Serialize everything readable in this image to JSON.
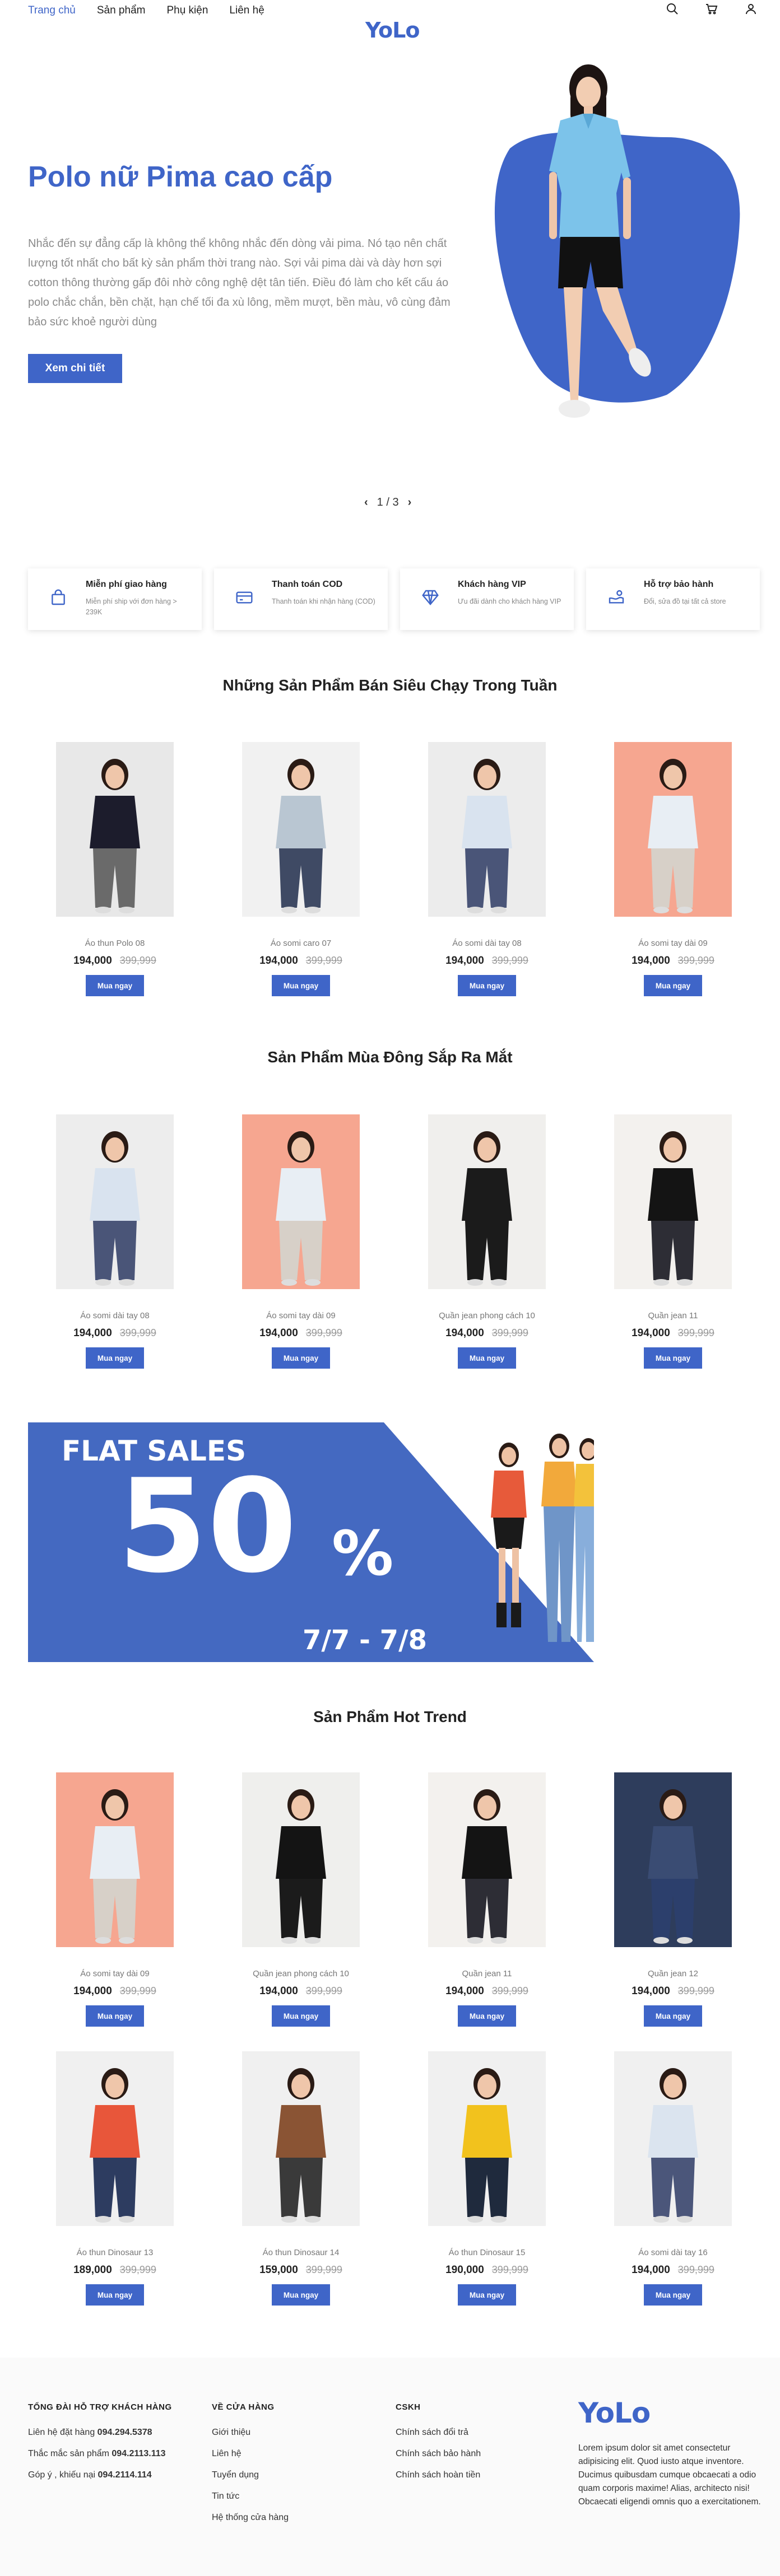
{
  "header": {
    "nav": [
      "Trang chủ",
      "Sản phẩm",
      "Phụ kiện",
      "Liên hệ"
    ],
    "logo": "YoLo",
    "icons": [
      "search-icon",
      "cart-icon",
      "user-icon"
    ]
  },
  "hero": {
    "title": "Polo nữ Pima cao cấp",
    "description": "Nhắc đến sự đẳng cấp là không thể không nhắc đến dòng vải pima. Nó tạo nên chất lượng tốt nhất cho bất kỳ sản phẩm thời trang nào. Sợi vải pima dài và dày hơn sợi cotton thông thường gấp đôi nhờ công nghệ dệt tân tiến. Điều đó làm cho kết cấu áo polo chắc chắn, bền chặt, hạn chế tối đa xù lông, mềm mượt, bền màu, vô cùng đảm bảo sức khoẻ người dùng",
    "button": "Xem chi tiết",
    "pager": "1 / 3"
  },
  "features": [
    {
      "title": "Miễn phí giao hàng",
      "desc": "Miễn phí ship với đơn hàng > 239K",
      "icon": "bag-icon"
    },
    {
      "title": "Thanh toán COD",
      "desc": "Thanh toán khi nhận hàng (COD)",
      "icon": "card-icon"
    },
    {
      "title": "Khách hàng VIP",
      "desc": "Ưu đãi dành cho khách hàng VIP",
      "icon": "diamond-icon"
    },
    {
      "title": "Hỗ trợ bảo hành",
      "desc": "Đổi, sửa đồ tại tất cả store",
      "icon": "support-icon"
    }
  ],
  "buy_label": "Mua ngay",
  "sections": [
    {
      "title": "Những Sản Phẩm Bán Siêu Chạy Trong Tuần",
      "products": [
        {
          "name": "Áo thun Polo 08",
          "price": "194,000",
          "old": "399,999"
        },
        {
          "name": "Áo somi caro 07",
          "price": "194,000",
          "old": "399,999"
        },
        {
          "name": "Áo somi dài tay 08",
          "price": "194,000",
          "old": "399,999"
        },
        {
          "name": "Áo somi tay dài 09",
          "price": "194,000",
          "old": "399,999"
        }
      ]
    },
    {
      "title": "Sản Phẩm Mùa Đông Sắp Ra Mắt",
      "products": [
        {
          "name": "Áo somi dài tay 08",
          "price": "194,000",
          "old": "399,999"
        },
        {
          "name": "Áo somi tay dài 09",
          "price": "194,000",
          "old": "399,999"
        },
        {
          "name": "Quần jean phong cách 10",
          "price": "194,000",
          "old": "399,999"
        },
        {
          "name": "Quần jean 11",
          "price": "194,000",
          "old": "399,999"
        }
      ]
    },
    {
      "title": "Sản Phẩm Hot Trend",
      "products": [
        {
          "name": "Áo somi tay dài 09",
          "price": "194,000",
          "old": "399,999"
        },
        {
          "name": "Quần jean phong cách 10",
          "price": "194,000",
          "old": "399,999"
        },
        {
          "name": "Quần jean 11",
          "price": "194,000",
          "old": "399,999"
        },
        {
          "name": "Quần jean 12",
          "price": "194,000",
          "old": "399,999"
        },
        {
          "name": "Áo thun Dinosaur 13",
          "price": "189,000",
          "old": "399,999"
        },
        {
          "name": "Áo thun Dinosaur 14",
          "price": "159,000",
          "old": "399,999"
        },
        {
          "name": "Áo thun Dinosaur 15",
          "price": "190,000",
          "old": "399,999"
        },
        {
          "name": "Áo somi dài tay 16",
          "price": "194,000",
          "old": "399,999"
        }
      ]
    }
  ],
  "banner": {
    "line1": "FLAT SALES",
    "big": "50",
    "pct": "%",
    "dates": "7/7 - 7/8"
  },
  "footer": {
    "col1": {
      "heading": "TỔNG ĐÀI HỖ TRỢ KHÁCH HÀNG",
      "items": [
        {
          "label": "Liên hệ đặt hàng",
          "value": "094.294.5378"
        },
        {
          "label": "Thắc mắc sản phẩm",
          "value": "094.2113.113"
        },
        {
          "label": "Góp ý , khiếu nại",
          "value": "094.2114.114"
        }
      ]
    },
    "col2": {
      "heading": "VỀ CỬA HÀNG",
      "items": [
        "Giới thiệu",
        "Liên hệ",
        "Tuyển dụng",
        "Tin tức",
        "Hệ thống cửa hàng"
      ]
    },
    "col3": {
      "heading": "CSKH",
      "items": [
        "Chính sách đổi trả",
        "Chính sách bảo hành",
        "Chính sách hoàn tiền"
      ]
    },
    "logo": "YoLo",
    "about": "Lorem ipsum dolor sit amet consectetur adipisicing elit. Quod iusto atque inventore. Ducimus quibusdam cumque obcaecati a odio quam corporis maxime! Alias, architecto nisi! Obcaecati eligendi omnis quo a exercitationem."
  }
}
